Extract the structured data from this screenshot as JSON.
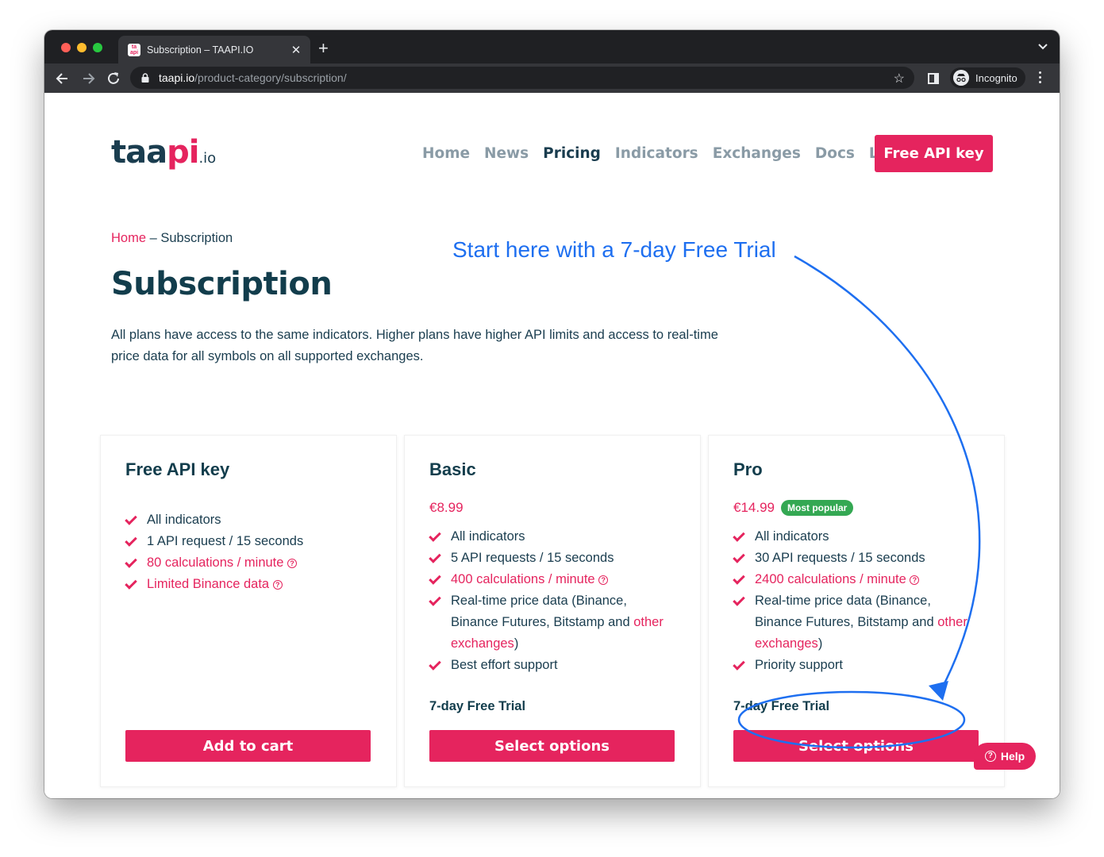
{
  "browser": {
    "tab_title": "Subscription – TAAPI.IO",
    "tab_close": "✕",
    "new_tab": "+",
    "url_host": "taapi.io",
    "url_path": "/product-category/subscription/",
    "profile": "Incognito"
  },
  "colors": {
    "brand": "#e5245e",
    "heading": "#123d4c",
    "annotation": "#1e6ff0",
    "badge": "#34a853"
  },
  "site": {
    "logo": {
      "main": "taa",
      "accent": "pi",
      "suffix": ".io"
    },
    "nav": [
      "Home",
      "News",
      "Pricing",
      "Indicators",
      "Exchanges",
      "Docs",
      "Log in"
    ],
    "active_nav": "Pricing",
    "cta": "Free API key",
    "help": "Help"
  },
  "breadcrumb": {
    "home": "Home",
    "separator": " – ",
    "current": "Subscription"
  },
  "page": {
    "title": "Subscription",
    "intro": "All plans have access to the same indicators. Higher plans have higher API limits and access to real-time price data for all symbols on all supported exchanges."
  },
  "annotation": "Start here with a 7-day Free Trial",
  "plans": [
    {
      "name": "Free API key",
      "price": "",
      "badge": "",
      "features": [
        {
          "text": "All indicators"
        },
        {
          "text": "1 API request / 15 seconds"
        },
        {
          "text": "80 calculations / minute",
          "link": true,
          "help": true
        },
        {
          "text": "Limited Binance data",
          "link": true,
          "help": true
        }
      ],
      "trial": "",
      "button": "Add to cart"
    },
    {
      "name": "Basic",
      "price": "€8.99",
      "badge": "",
      "features": [
        {
          "text": "All indicators"
        },
        {
          "text": "5 API requests / 15 seconds"
        },
        {
          "text": "400 calculations / minute",
          "link": true,
          "help": true
        },
        {
          "text": "Real-time price data (Binance, Binance Futures, Bitstamp and ",
          "link_text": "other exchanges",
          "after": ")"
        },
        {
          "text": "Best effort support"
        }
      ],
      "trial": "7-day Free Trial",
      "button": "Select options"
    },
    {
      "name": "Pro",
      "price": "€14.99",
      "badge": "Most popular",
      "features": [
        {
          "text": "All indicators"
        },
        {
          "text": "30 API requests / 15 seconds"
        },
        {
          "text": "2400 calculations / minute",
          "link": true,
          "help": true
        },
        {
          "text": "Real-time price data (Binance, Binance Futures, Bitstamp and ",
          "link_text": "other exchanges",
          "after": ")"
        },
        {
          "text": "Priority support"
        }
      ],
      "trial": "7-day Free Trial",
      "button": "Select options"
    }
  ]
}
